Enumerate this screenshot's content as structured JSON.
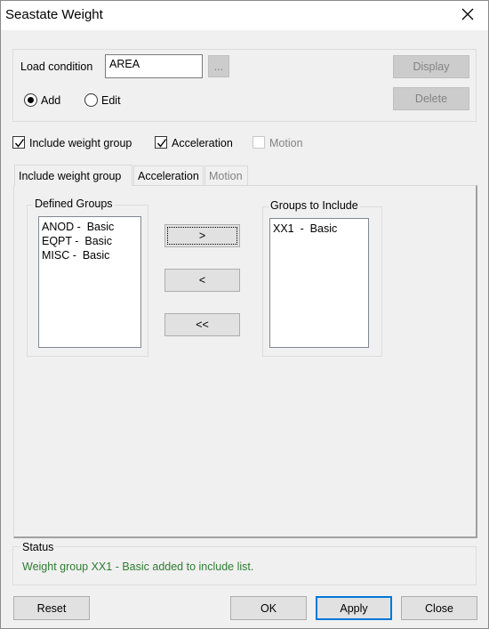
{
  "window": {
    "title": "Seastate Weight"
  },
  "load": {
    "label": "Load condition",
    "value": "AREA",
    "browse_label": "...",
    "display_label": "Display",
    "delete_label": "Delete"
  },
  "mode": {
    "add_label": "Add",
    "edit_label": "Edit",
    "selected": "Add"
  },
  "options": {
    "include_weight_group": {
      "label": "Include weight group",
      "checked": true
    },
    "acceleration": {
      "label": "Acceleration",
      "checked": true
    },
    "motion": {
      "label": "Motion",
      "checked": false,
      "enabled": false
    }
  },
  "tabs": [
    {
      "label": "Include weight group",
      "active": true
    },
    {
      "label": "Acceleration",
      "active": false
    },
    {
      "label": "Motion",
      "active": false,
      "enabled": false
    }
  ],
  "defined_groups": {
    "title": "Defined Groups",
    "items": [
      "ANOD -  Basic",
      "EQPT -  Basic",
      "MISC -  Basic"
    ]
  },
  "include_groups": {
    "title": "Groups to Include",
    "items": [
      "XX1  -  Basic"
    ]
  },
  "transfer": {
    "add_label": ">",
    "remove_label": "<",
    "remove_all_label": "<<"
  },
  "status": {
    "title": "Status",
    "message": "Weight group XX1  -  Basic added to include list.",
    "color": "#2e7d32"
  },
  "footer": {
    "reset_label": "Reset",
    "ok_label": "OK",
    "apply_label": "Apply",
    "close_label": "Close"
  },
  "colors": {
    "accent": "#0078d7"
  }
}
